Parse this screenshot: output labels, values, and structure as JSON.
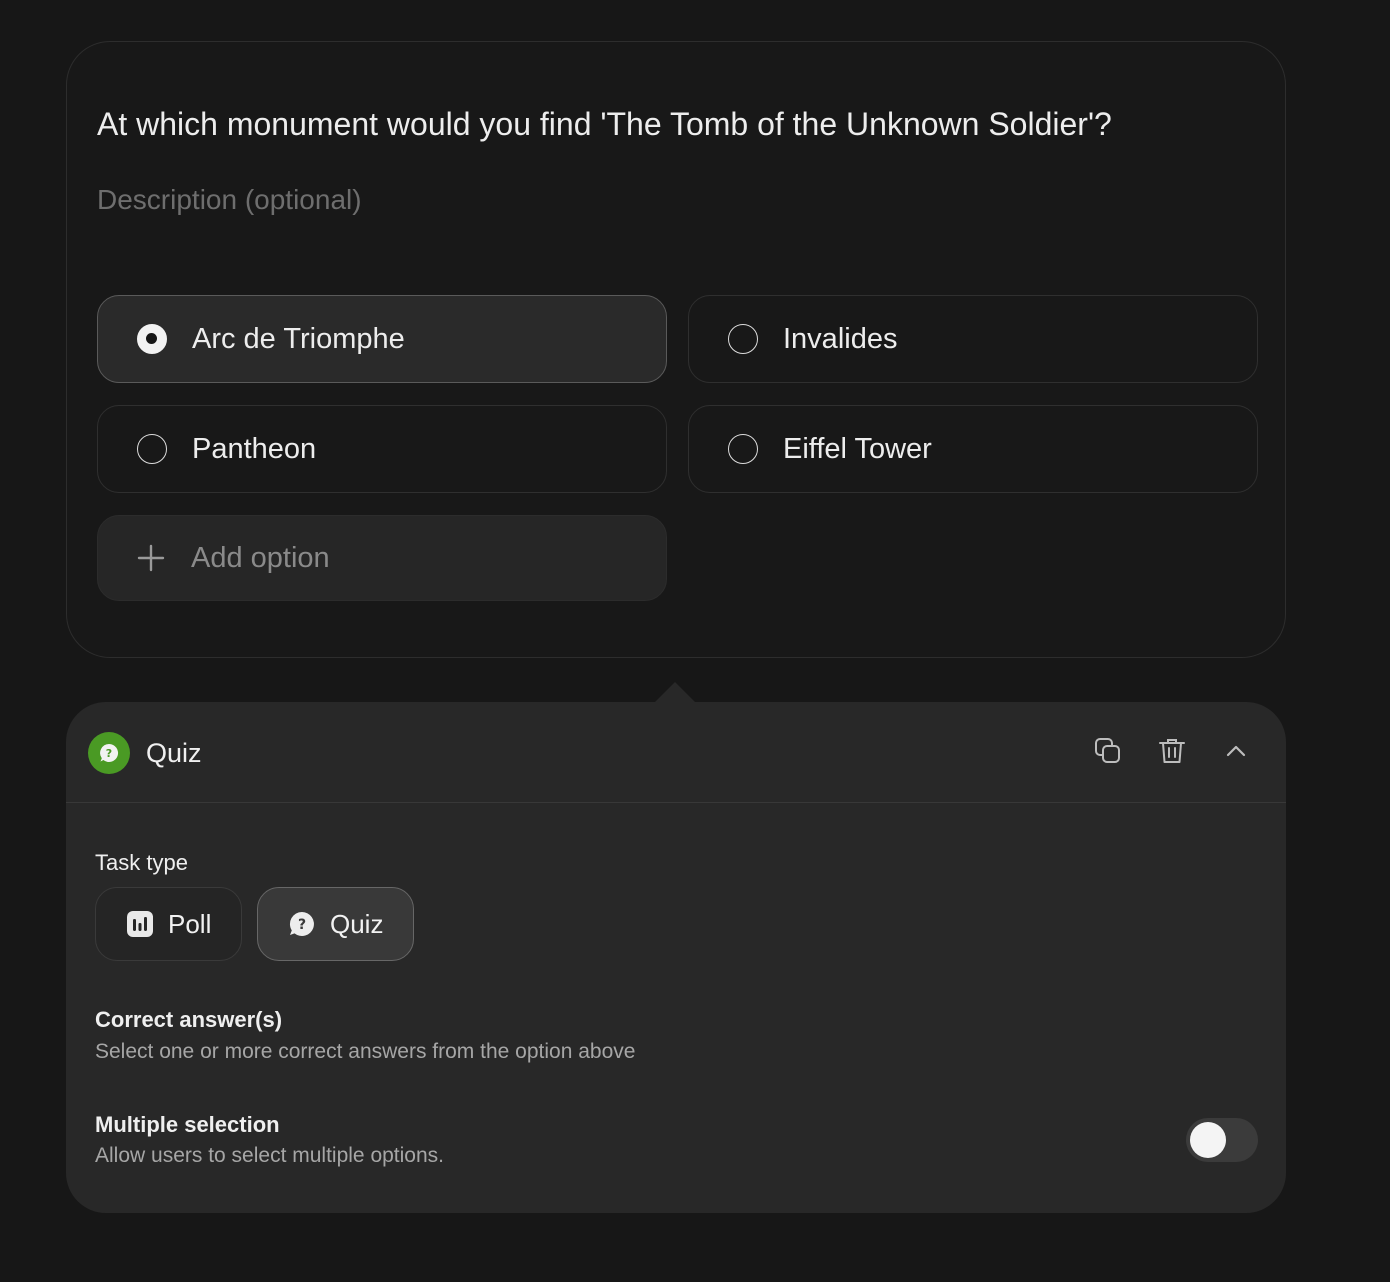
{
  "question": {
    "title": "At which monument would you find 'The Tomb of the Unknown Soldier'?",
    "description_placeholder": "Description (optional)",
    "options": [
      {
        "label": "Arc de Triomphe",
        "selected": true
      },
      {
        "label": "Invalides",
        "selected": false
      },
      {
        "label": "Pantheon",
        "selected": false
      },
      {
        "label": "Eiffel Tower",
        "selected": false
      }
    ],
    "add_option_label": "Add option"
  },
  "settings": {
    "title": "Quiz",
    "badge_icon": "quiz-icon",
    "badge_color": "#4a9a24",
    "actions": [
      "duplicate-icon",
      "trash-icon",
      "chevron-up-icon"
    ],
    "task_type": {
      "label": "Task type",
      "options": [
        {
          "label": "Poll",
          "icon": "poll-icon",
          "active": false
        },
        {
          "label": "Quiz",
          "icon": "quiz-icon",
          "active": true
        }
      ]
    },
    "correct_answers": {
      "title": "Correct answer(s)",
      "subtitle": "Select one or more correct answers from the option above"
    },
    "multiple_selection": {
      "title": "Multiple selection",
      "subtitle": "Allow users to select multiple options.",
      "enabled": false
    }
  }
}
